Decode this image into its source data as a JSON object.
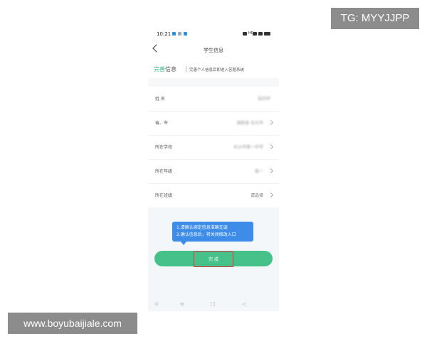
{
  "watermarks": {
    "top": "TG: MYYJJPP",
    "bottom": "www.boyubaijiale.com"
  },
  "status_bar": {
    "time": "10:21",
    "indicators": "HD"
  },
  "nav": {
    "title": "学生信息"
  },
  "banner": {
    "title_accent": "完善",
    "title_rest": "信息",
    "text": "完善个人信息后即进入答题系统"
  },
  "rows": [
    {
      "label": "姓  名",
      "value": "张同学",
      "chevron": false
    },
    {
      "label": "省、市",
      "value": "湖南省 长沙市",
      "chevron": true
    },
    {
      "label": "所在学校",
      "value": "长沙市第一中学",
      "chevron": true
    },
    {
      "label": "所在年级",
      "value": "高一",
      "chevron": true
    },
    {
      "label": "所在班级",
      "value": "请选择",
      "chevron": true
    }
  ],
  "tooltip": {
    "line1": "1.请确认绑定信息准确无误",
    "line2": "2.确认信息后，将关闭修改入口"
  },
  "done_button": {
    "label": "完 成"
  },
  "system_nav": {
    "keys": [
      "⊙",
      "≡",
      "□",
      "◁"
    ]
  },
  "colors": {
    "accent": "#46c18a",
    "tooltip": "#3d8ce8",
    "highlight": "#d63a3a"
  }
}
